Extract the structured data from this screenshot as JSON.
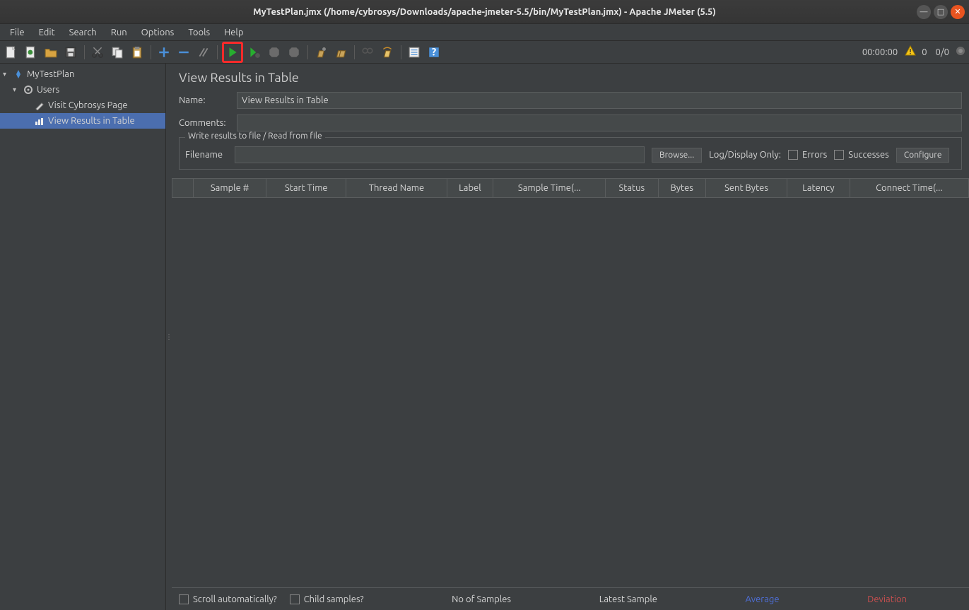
{
  "window": {
    "title": "MyTestPlan.jmx (/home/cybrosys/Downloads/apache-jmeter-5.5/bin/MyTestPlan.jmx) - Apache JMeter (5.5)"
  },
  "menubar": [
    "File",
    "Edit",
    "Search",
    "Run",
    "Options",
    "Tools",
    "Help"
  ],
  "toolbar_status": {
    "time": "00:00:00",
    "active": "0",
    "total": "0/0"
  },
  "tree": {
    "root": "MyTestPlan",
    "group": "Users",
    "sampler": "Visit Cybrosys Page",
    "listener": "View Results in Table"
  },
  "panel": {
    "title": "View Results in Table",
    "name_label": "Name:",
    "name_value": "View Results in Table",
    "comments_label": "Comments:",
    "comments_value": "",
    "fieldset_legend": "Write results to file / Read from file",
    "filename_label": "Filename",
    "filename_value": "",
    "browse_btn": "Browse...",
    "logdisplay_label": "Log/Display Only:",
    "errors_label": "Errors",
    "successes_label": "Successes",
    "configure_btn": "Configure",
    "columns": [
      "Sample #",
      "Start Time",
      "Thread Name",
      "Label",
      "Sample Time(...",
      "Status",
      "Bytes",
      "Sent Bytes",
      "Latency",
      "Connect Time(..."
    ]
  },
  "footer": {
    "scroll_auto": "Scroll automatically?",
    "child_samples": "Child samples?",
    "no_samples": "No of Samples",
    "latest_sample": "Latest Sample",
    "average": "Average",
    "deviation": "Deviation"
  }
}
